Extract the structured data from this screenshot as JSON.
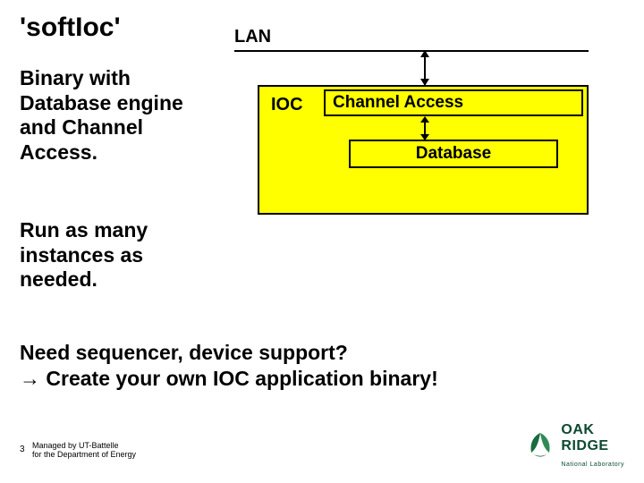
{
  "title": "'softIoc'",
  "lan_label": "LAN",
  "ioc_label": "IOC",
  "ca_label": "Channel Access",
  "db_label": "Database",
  "desc1": "Binary with Database engine and Channel Access.",
  "desc2": "Run as many instances as needed.",
  "desc3": "Need sequencer, device support?\n→ Create your own IOC application binary!",
  "footer": {
    "page_num": "3",
    "managed": "Managed by UT-Battelle\nfor the Department of Energy"
  },
  "logo": {
    "main": "OAK",
    "main2": "RIDGE",
    "sub": "National Laboratory"
  }
}
